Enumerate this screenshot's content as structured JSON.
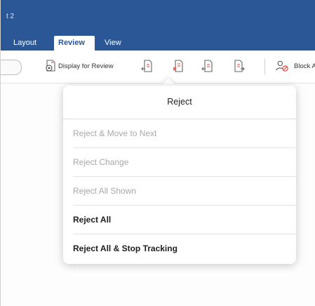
{
  "window": {
    "title_fragment": "t 2"
  },
  "ribbon": {
    "tabs": [
      {
        "label": "Layout",
        "selected": false
      },
      {
        "label": "Review",
        "selected": true
      },
      {
        "label": "View",
        "selected": false
      }
    ]
  },
  "toolbar": {
    "display_for_review_label": "Display for Review",
    "block_authors_label": "Block A",
    "icons": [
      "display-review-icon",
      "previous-change-icon",
      "reject-icon",
      "accept-icon",
      "next-change-icon",
      "block-authors-icon"
    ]
  },
  "reject_menu": {
    "title": "Reject",
    "items": [
      {
        "label": "Reject & Move to Next",
        "enabled": false
      },
      {
        "label": "Reject Change",
        "enabled": false
      },
      {
        "label": "Reject All Shown",
        "enabled": false
      },
      {
        "label": "Reject All",
        "enabled": true
      },
      {
        "label": "Reject All & Stop Tracking",
        "enabled": true
      }
    ]
  },
  "colors": {
    "ribbon_blue": "#2b5797",
    "disabled_text": "#a8a8a8",
    "enabled_text": "#1d1d1d",
    "reject_red": "#e0443a"
  }
}
